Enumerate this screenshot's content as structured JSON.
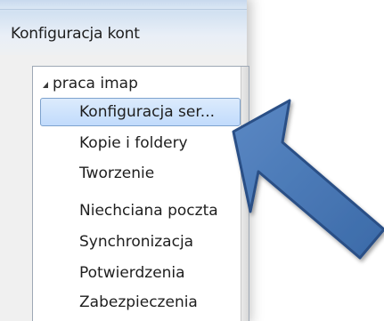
{
  "window": {
    "title": "Konfiguracja kont"
  },
  "tree": {
    "root_label": "praca imap",
    "items": [
      {
        "label": "Konfiguracja ser...",
        "selected": true
      },
      {
        "label": "Kopie i foldery",
        "selected": false
      },
      {
        "label": "Tworzenie",
        "selected": false
      },
      {
        "label": "Niechciana poczta",
        "selected": false
      },
      {
        "label": "Synchronizacja",
        "selected": false
      },
      {
        "label": "Potwierdzenia",
        "selected": false
      },
      {
        "label": "Zabezpieczenia",
        "selected": false
      }
    ]
  },
  "annotation": {
    "icon": "arrow-pointer-icon",
    "fill_color": "#3d6fb0",
    "stroke_color": "#2a4f86"
  },
  "colors": {
    "selection_fill": "#c8defb",
    "selection_border": "#7da2ce",
    "dialog_background": "#f0f0f0"
  }
}
